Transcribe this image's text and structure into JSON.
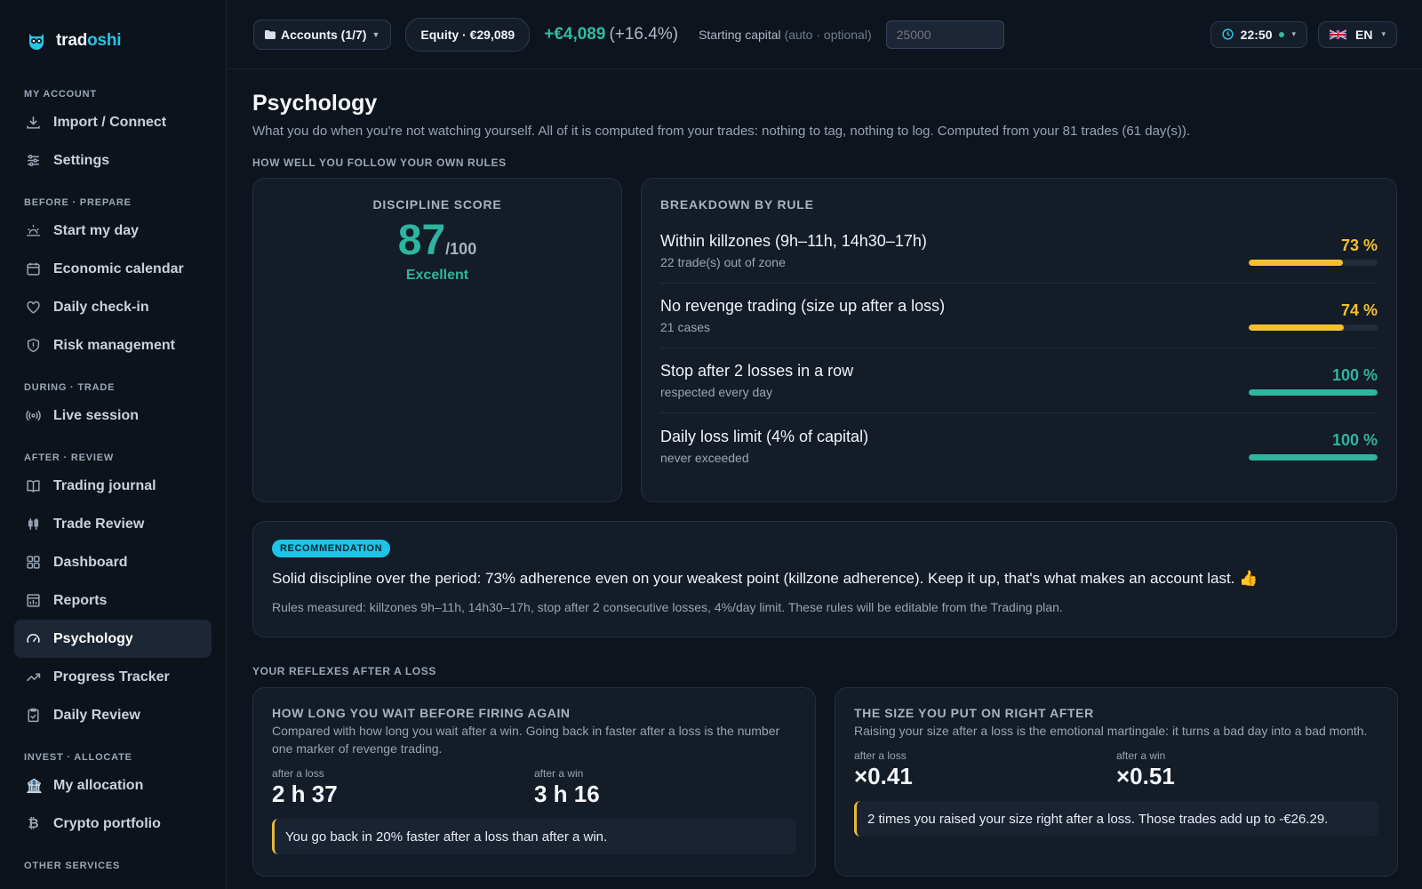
{
  "brand": {
    "name_part1": "trad",
    "name_part2": "oshi"
  },
  "sidebar": {
    "sections": {
      "my_account": "MY ACCOUNT",
      "before": "BEFORE · PREPARE",
      "during": "DURING · TRADE",
      "after": "AFTER · REVIEW",
      "invest": "INVEST · ALLOCATE",
      "other": "OTHER SERVICES"
    },
    "items": {
      "import": "Import / Connect",
      "settings": "Settings",
      "start_day": "Start my day",
      "economic_calendar": "Economic calendar",
      "daily_checkin": "Daily check-in",
      "risk_management": "Risk management",
      "live_session": "Live session",
      "trading_journal": "Trading journal",
      "trade_review": "Trade Review",
      "dashboard": "Dashboard",
      "reports": "Reports",
      "psychology": "Psychology",
      "progress_tracker": "Progress Tracker",
      "daily_review": "Daily Review",
      "my_allocation": "My allocation",
      "crypto_portfolio": "Crypto portfolio"
    }
  },
  "topbar": {
    "accounts_label": "Accounts (1/7)",
    "equity_label": "Equity · €29,089",
    "pnl_value": "+€4,089",
    "pnl_pct": "(+16.4%)",
    "capital_label": "Starting capital",
    "capital_hint": "(auto · optional)",
    "capital_placeholder": "25000",
    "time": "22:50",
    "language": "EN",
    "accent_color": "#2dbd9f"
  },
  "page": {
    "title": "Psychology",
    "subtitle": "What you do when you're not watching yourself. All of it is computed from your trades: nothing to tag, nothing to log. Computed from your 81 trades (61 day(s))."
  },
  "discipline": {
    "section_label": "HOW WELL YOU FOLLOW YOUR OWN RULES",
    "score_label": "DISCIPLINE SCORE",
    "score": "87",
    "score_denominator": "/100",
    "verdict": "Excellent",
    "breakdown_label": "BREAKDOWN BY RULE",
    "rules": [
      {
        "title": "Within killzones (9h–11h, 14h30–17h)",
        "note": "22 trade(s) out of zone",
        "pct_label": "73 %",
        "value": 73,
        "color": "#f2c12e"
      },
      {
        "title": "No revenge trading (size up after a loss)",
        "note": "21 cases",
        "pct_label": "74 %",
        "value": 74,
        "color": "#f2c12e"
      },
      {
        "title": "Stop after 2 losses in a row",
        "note": "respected every day",
        "pct_label": "100 %",
        "value": 100,
        "color": "#2db5a0"
      },
      {
        "title": "Daily loss limit (4% of capital)",
        "note": "never exceeded",
        "pct_label": "100 %",
        "value": 100,
        "color": "#2db5a0"
      }
    ]
  },
  "recommendation": {
    "badge": "RECOMMENDATION",
    "text": "Solid discipline over the period: 73% adherence even on your weakest point (killzone adherence). Keep it up, that's what makes an account last. 👍",
    "footnote": "Rules measured: killzones 9h–11h, 14h30–17h, stop after 2 consecutive losses, 4%/day limit. These rules will be editable from the Trading plan."
  },
  "reflexes": {
    "section_label": "YOUR REFLEXES AFTER A LOSS",
    "wait": {
      "title": "HOW LONG YOU WAIT BEFORE FIRING AGAIN",
      "desc": "Compared with how long you wait after a win. Going back in faster after a loss is the number one marker of revenge trading.",
      "after_loss_label": "after a loss",
      "after_loss_value": "2 h 37",
      "after_win_label": "after a win",
      "after_win_value": "3 h 16",
      "insight": "You go back in 20% faster after a loss than after a win."
    },
    "size": {
      "title": "THE SIZE YOU PUT ON RIGHT AFTER",
      "desc": "Raising your size after a loss is the emotional martingale: it turns a bad day into a bad month.",
      "after_loss_label": "after a loss",
      "after_loss_value": "×0.41",
      "after_win_label": "after a win",
      "after_win_value": "×0.51",
      "insight": "2 times you raised your size right after a loss. Those trades add up to -€26.29."
    }
  }
}
